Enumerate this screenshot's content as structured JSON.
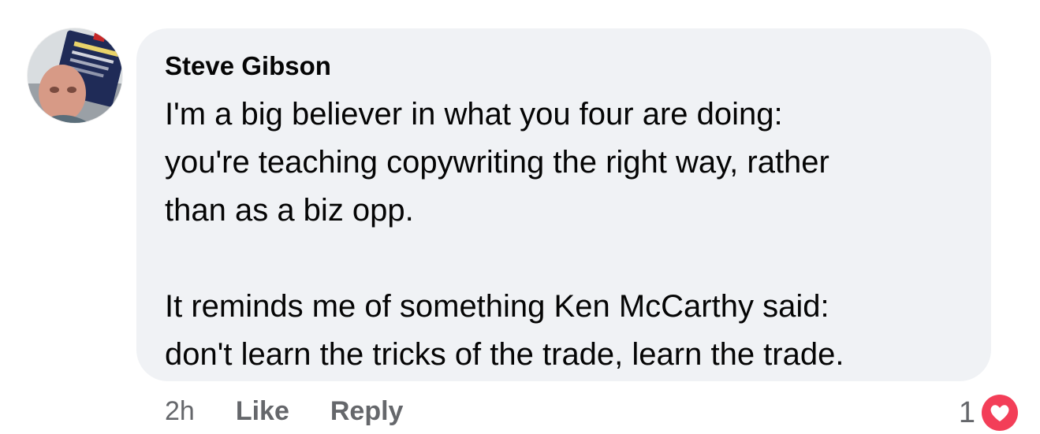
{
  "comment": {
    "author": "Steve Gibson",
    "paragraphs": [
      "I'm a big believer in what you four are doing:\nyou're teaching copywriting the right way, rather\nthan as a biz opp.",
      "It reminds me of something Ken McCarthy said:\ndon't learn the tricks of the trade, learn the trade."
    ],
    "timestamp": "2h",
    "like_label": "Like",
    "reply_label": "Reply",
    "reaction_count": "1",
    "reaction_icon": "heart-icon",
    "colors": {
      "bubble": "#f0f2f5",
      "meta_text": "#65676b",
      "heart": "#f33e58"
    }
  }
}
